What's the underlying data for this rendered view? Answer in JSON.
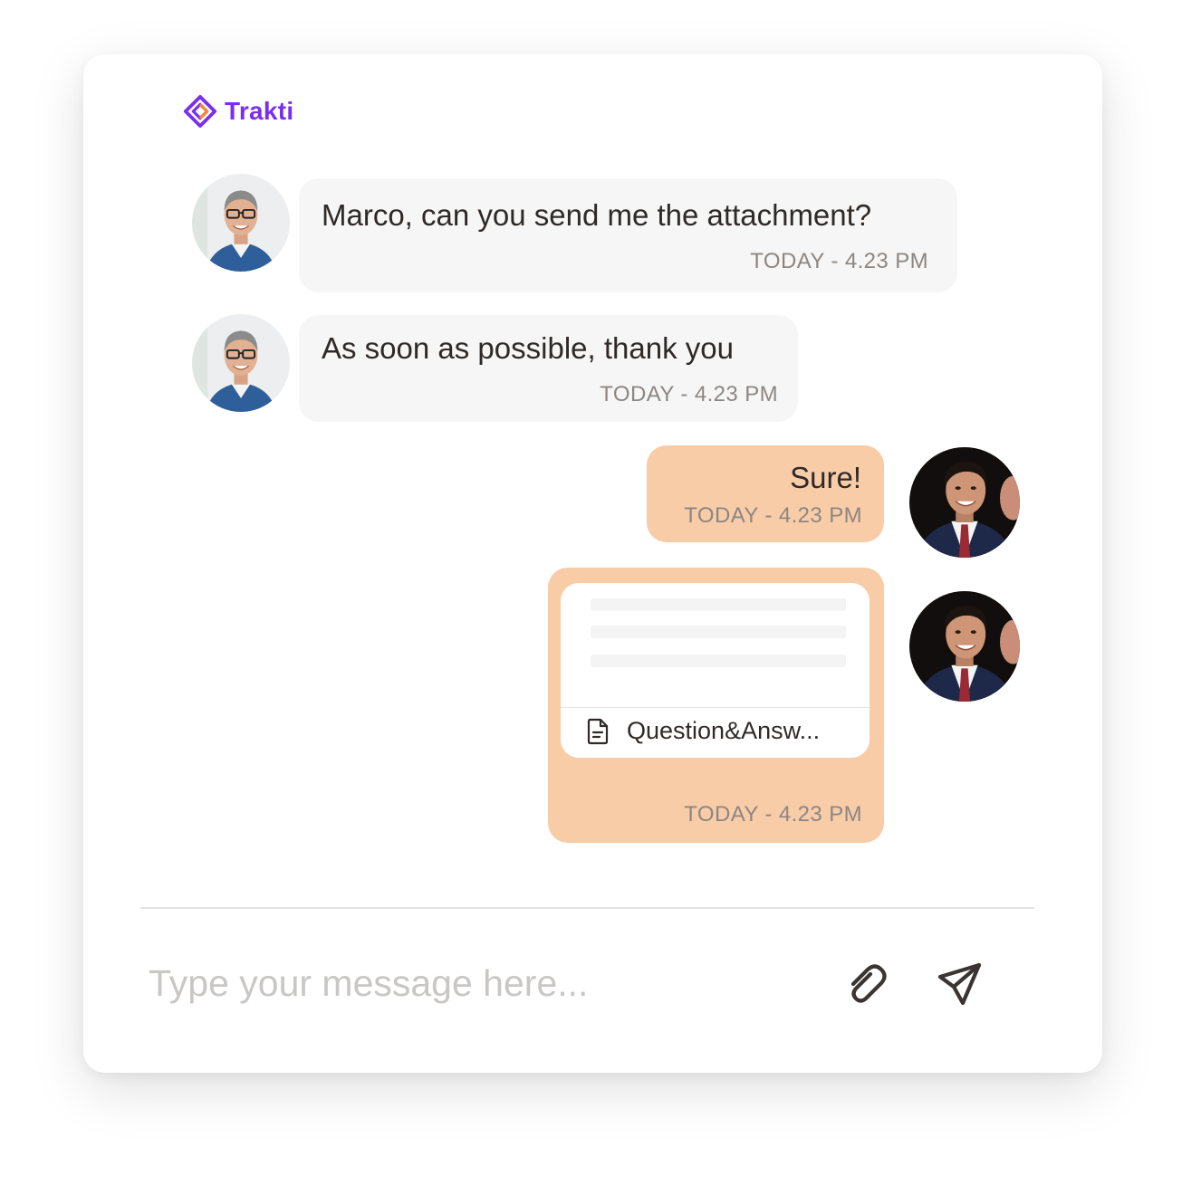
{
  "brand": {
    "name": "Trakti",
    "color": "#7a2ff0",
    "accent": "#f28a2e"
  },
  "messages": [
    {
      "direction": "incoming",
      "text": "Marco, can you send me the attachment?",
      "time": "TODAY - 4.23 PM",
      "avatar": "gray-haired-man-avatar"
    },
    {
      "direction": "incoming",
      "text": "As soon as possible, thank you",
      "time": "TODAY - 4.23 PM",
      "avatar": "gray-haired-man-avatar"
    },
    {
      "direction": "outgoing",
      "text": "Sure!",
      "time": "TODAY - 4.23 PM",
      "avatar": "dark-haired-man-avatar"
    },
    {
      "direction": "outgoing",
      "attachment": {
        "file_name": "Question&Answ...",
        "icon": "document-icon"
      },
      "time": "TODAY - 4.23 PM",
      "avatar": "dark-haired-man-avatar"
    }
  ],
  "composer": {
    "placeholder": "Type your message here...",
    "attach_icon": "paperclip-icon",
    "send_icon": "send-icon"
  },
  "colors": {
    "incoming_bubble": "#f6f6f6",
    "outgoing_bubble": "#f9cca8",
    "text": "#2f2a28",
    "timestamp": "#8c8682"
  }
}
